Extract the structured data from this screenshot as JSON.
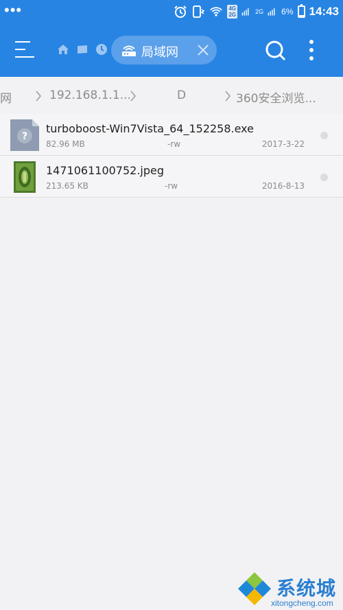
{
  "status_bar": {
    "time": "14:43",
    "battery": "6%",
    "network_top": "4G",
    "network_bottom": "2G",
    "network_second": "2G"
  },
  "app_bar": {
    "tab_label": "局域网",
    "icons": [
      "menu-icon",
      "home-icon",
      "device-icon",
      "clock-icon",
      "router-icon",
      "close-icon",
      "search-icon",
      "more-icon"
    ]
  },
  "breadcrumb": {
    "items": [
      "网",
      "192.168.1.1...",
      "D",
      "360安全浏览..."
    ]
  },
  "files": [
    {
      "name": "turboboost-Win7Vista_64_152258.exe",
      "size": "82.96 MB",
      "perm": "-rw",
      "date": "2017-3-22",
      "icon": "unknown-file-icon"
    },
    {
      "name": "1471061100752.jpeg",
      "size": "213.65 KB",
      "perm": "-rw",
      "date": "2016-8-13",
      "icon": "image-thumbnail"
    }
  ],
  "watermark": {
    "text": "系统城",
    "url": "xitongcheng.com"
  },
  "colors": {
    "primary": "#2784e3",
    "chip": "#5ba0ea",
    "background": "#f2f2f4"
  }
}
